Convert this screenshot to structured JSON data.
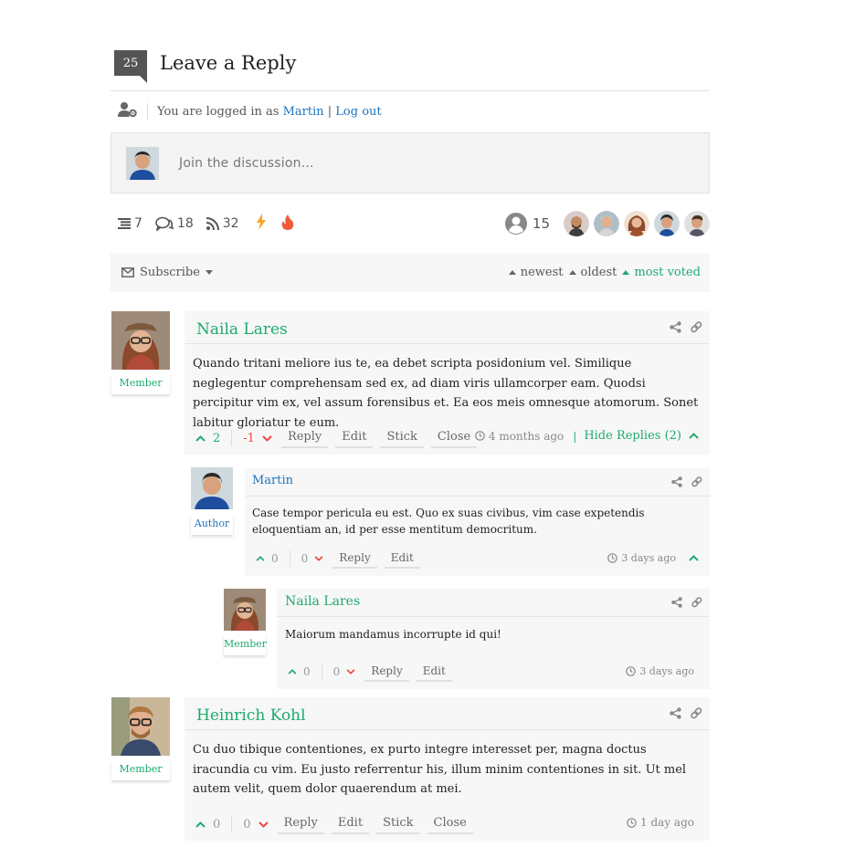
{
  "header": {
    "count": "25",
    "title": "Leave a Reply"
  },
  "login": {
    "prefix": "You are logged in as",
    "user": "Martin",
    "separator": "|",
    "logout": "Log out"
  },
  "editor": {
    "placeholder": "Join the discussion..."
  },
  "stats": {
    "threads": "7",
    "replies": "18",
    "followers": "32",
    "authors_count": "15"
  },
  "sortbar": {
    "subscribe": "Subscribe",
    "newest": "newest",
    "oldest": "oldest",
    "most_voted": "most voted"
  },
  "comments": [
    {
      "author": "Naila Lares",
      "role": "Member",
      "text": "Quando tritani meliore ius te, ea debet scripta posidonium vel. Similique neglegentur comprehensam sed ex, ad diam viris ullamcorper eam. Quodsi percipitur vim ex, vel assum forensibus et. Ea eos meis omnesque atomorum. Sonet labitur gloriatur te eum.",
      "up": "2",
      "down": "-1",
      "reply": "Reply",
      "edit": "Edit",
      "stick": "Stick",
      "close": "Close",
      "time": "4 months ago",
      "hide_replies": "Hide Replies (2)"
    },
    {
      "author": "Martin",
      "role": "Author",
      "text": "Case tempor pericula eu est. Quo ex suas civibus, vim case expetendis eloquentiam an, id per esse mentitum democritum.",
      "up": "0",
      "down": "0",
      "reply": "Reply",
      "edit": "Edit",
      "time": "3 days ago"
    },
    {
      "author": "Naila Lares",
      "role": "Member",
      "text": "Maiorum mandamus incorrupte id qui!",
      "up": "0",
      "down": "0",
      "reply": "Reply",
      "edit": "Edit",
      "time": "3 days ago"
    },
    {
      "author": "Heinrich Kohl",
      "role": "Member",
      "text": "Cu duo tibique contentiones, ex purto integre interesset per, magna doctus iracundia cu vim. Eu justo referrentur his, illum minim contentiones in sit. Ut mel autem velit, quem dolor quaerendum at mei.",
      "up": "0",
      "down": "0",
      "reply": "Reply",
      "edit": "Edit",
      "stick": "Stick",
      "close": "Close",
      "time": "1 day ago"
    }
  ],
  "colors": {
    "accent": "#1dab6e",
    "link": "#1e73be",
    "down": "#e44444",
    "badge": "#555555"
  }
}
